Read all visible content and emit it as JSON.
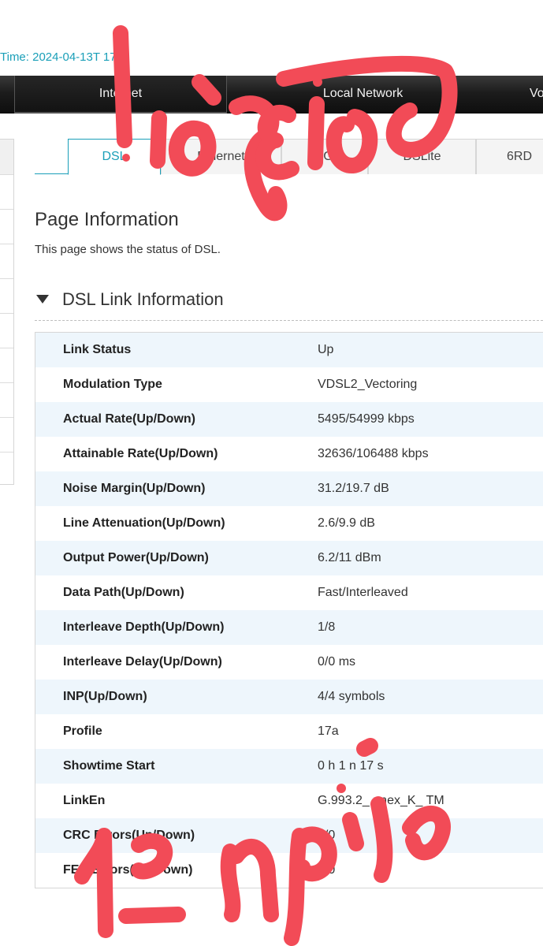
{
  "header": {
    "system_time": "Time: 2024-04-13T   17"
  },
  "nav": {
    "items": [
      "",
      "Internet",
      "Local Network",
      "Vo"
    ]
  },
  "tabs": [
    "DSL",
    "Ethernet",
    "3G",
    "DSLite",
    "6RD"
  ],
  "page": {
    "title": "Page Information",
    "description": "This page shows the status of DSL."
  },
  "section": {
    "title": "DSL Link Information"
  },
  "rows": [
    {
      "label": "Link Status",
      "value": "Up"
    },
    {
      "label": "Modulation Type",
      "value": "VDSL2_Vectoring"
    },
    {
      "label": "Actual Rate(Up/Down)",
      "value": "5495/54999 kbps"
    },
    {
      "label": "Attainable Rate(Up/Down)",
      "value": "32636/106488 kbps"
    },
    {
      "label": "Noise Margin(Up/Down)",
      "value": "31.2/19.7 dB"
    },
    {
      "label": "Line Attenuation(Up/Down)",
      "value": "2.6/9.9 dB"
    },
    {
      "label": "Output Power(Up/Down)",
      "value": "6.2/11 dBm"
    },
    {
      "label": "Data Path(Up/Down)",
      "value": "Fast/Interleaved"
    },
    {
      "label": "Interleave Depth(Up/Down)",
      "value": "1/8"
    },
    {
      "label": "Interleave Delay(Up/Down)",
      "value": "0/0 ms"
    },
    {
      "label": "INP(Up/Down)",
      "value": "4/4 symbols"
    },
    {
      "label": "Profile",
      "value": "17a"
    },
    {
      "label": "Showtime Start",
      "value": "0 h 1    n 17 s"
    },
    {
      "label": "LinkEn",
      "value": "G.993.2_ nnex_K_ TM"
    },
    {
      "label": "CRC Errors(Up/Down)",
      "value": "0/0"
    },
    {
      "label": "FEC Errors(Up/Down)",
      "value": "0/0"
    }
  ],
  "annotations": {
    "top_handwriting": "Ισόγειο",
    "bottom_handwriting": "13 Απρίλη",
    "ink_color": "#f24b57"
  }
}
